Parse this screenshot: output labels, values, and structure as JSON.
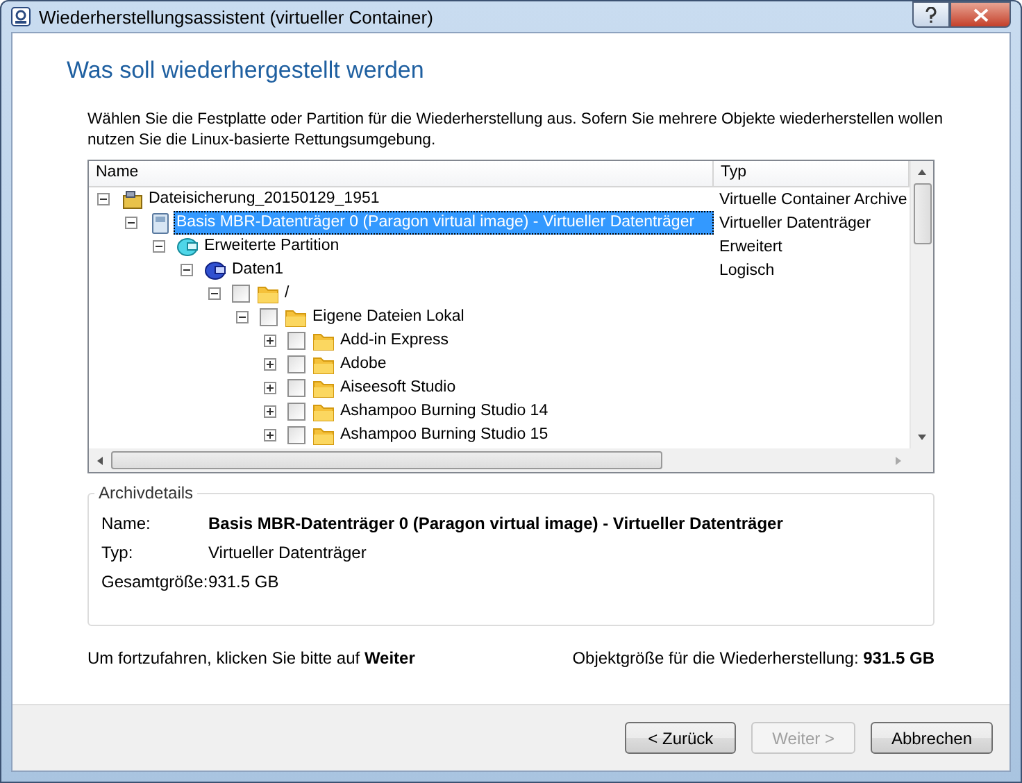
{
  "window": {
    "title": "Wiederherstellungsassistent (virtueller Container)"
  },
  "heading": "Was soll wiederhergestellt werden",
  "instruction": "Wählen Sie die Festplatte oder Partition für die Wiederherstellung aus. Sofern Sie mehrere Objekte wiederherstellen wollen nutzen Sie die Linux-basierte Rettungsumgebung.",
  "tree": {
    "columns": [
      "Name",
      "Typ"
    ],
    "items": [
      {
        "kind": "archive",
        "label": "Dateisicherung_20150129_1951",
        "type": "Virtuelle Container Archive",
        "expanded": true,
        "selected": false,
        "children": [
          {
            "kind": "disk",
            "label": "Basis MBR-Datenträger 0 (Paragon virtual image) - Virtueller Datenträger",
            "type": "Virtueller Datenträger",
            "expanded": true,
            "selected": true,
            "children": [
              {
                "kind": "partition",
                "label": "Erweiterte Partition",
                "type": "Erweitert",
                "expanded": true,
                "selected": false,
                "children": [
                  {
                    "kind": "volume",
                    "label": "Daten1",
                    "type": "Logisch",
                    "expanded": true,
                    "selected": false,
                    "children": [
                      {
                        "kind": "folder",
                        "label": "/",
                        "checked": false,
                        "expanded": true,
                        "selected": false,
                        "children": [
                          {
                            "kind": "folder",
                            "label": "Eigene Dateien Lokal",
                            "checked": false,
                            "expanded": true,
                            "selected": false,
                            "children": [
                              {
                                "kind": "folder",
                                "label": "Add-in Express",
                                "checked": false,
                                "expanded": false,
                                "selected": false
                              },
                              {
                                "kind": "folder",
                                "label": "Adobe",
                                "checked": false,
                                "expanded": false,
                                "selected": false
                              },
                              {
                                "kind": "folder",
                                "label": "Aiseesoft Studio",
                                "checked": false,
                                "expanded": false,
                                "selected": false
                              },
                              {
                                "kind": "folder",
                                "label": "Ashampoo Burning Studio 14",
                                "checked": false,
                                "expanded": false,
                                "selected": false
                              },
                              {
                                "kind": "folder",
                                "label": "Ashampoo Burning Studio 15",
                                "checked": false,
                                "expanded": false,
                                "selected": false
                              }
                            ]
                          }
                        ]
                      }
                    ]
                  }
                ]
              }
            ]
          }
        ]
      }
    ]
  },
  "details": {
    "legend": "Archivdetails",
    "rows": [
      {
        "label": "Name:",
        "value": "Basis MBR-Datenträger 0 (Paragon virtual image) - Virtueller Datenträger",
        "emphasis": true
      },
      {
        "label": "Typ:",
        "value": "Virtueller Datenträger",
        "emphasis": false
      },
      {
        "label": "Gesamtgröße:",
        "value": "931.5 GB",
        "emphasis": false
      }
    ]
  },
  "hint": "Um fortzufahren, klicken Sie bitte auf **Weiter**",
  "size_summary": "Objektgröße für die Wiederherstellung: **931.5 GB**",
  "buttons": [
    {
      "label": "< Zurück",
      "disabled": false
    },
    {
      "label": "Weiter >",
      "disabled": true
    },
    {
      "label": "Abbrechen",
      "disabled": false
    }
  ]
}
